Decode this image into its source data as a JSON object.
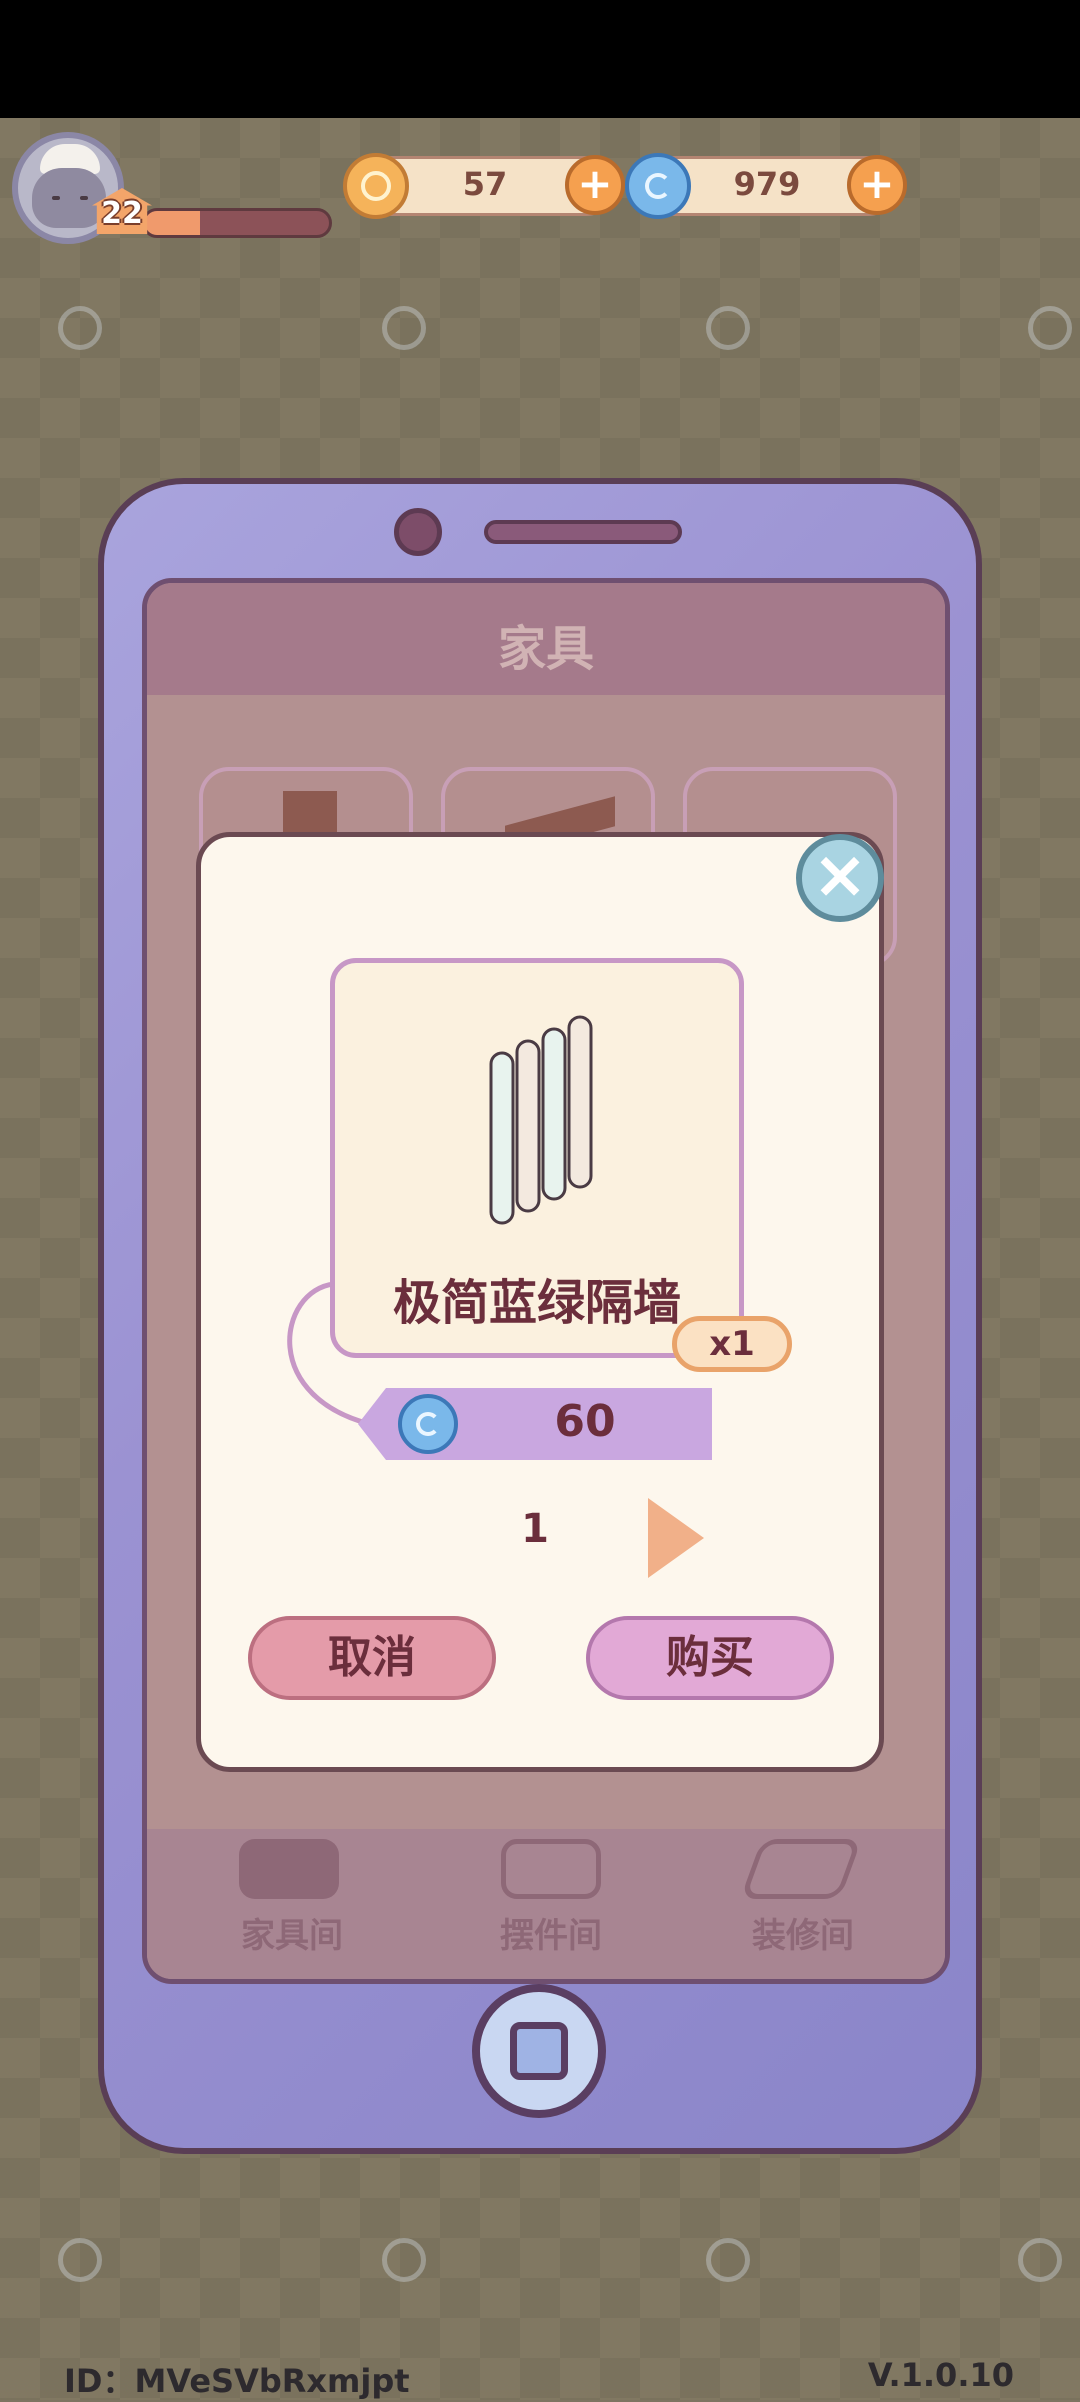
{
  "hud": {
    "level": "22",
    "xp_progress": 0.3,
    "coins": "57",
    "gems": "979"
  },
  "phone_screen": {
    "title": "家具",
    "tabs": [
      {
        "label": "家具间",
        "icon": "armchair-icon"
      },
      {
        "label": "摆件间",
        "icon": "teacup-icon"
      },
      {
        "label": "装修间",
        "icon": "floor-tile-icon"
      }
    ]
  },
  "purchase_dialog": {
    "item_name": "极简蓝绿隔墙",
    "item_qty": "x1",
    "price": "60",
    "price_currency_icon": "gem-icon",
    "quantity": "1",
    "cancel_label": "取消",
    "buy_label": "购买"
  },
  "footer": {
    "id_text": "ID：MVeSVbRxmjpt",
    "version": "V.1.0.10"
  },
  "colors": {
    "dialog_bg": "#fdf7ed",
    "cancel_button": "#e49ba9",
    "buy_button": "#e2a9d6",
    "price_tag": "#c9a7e0"
  }
}
